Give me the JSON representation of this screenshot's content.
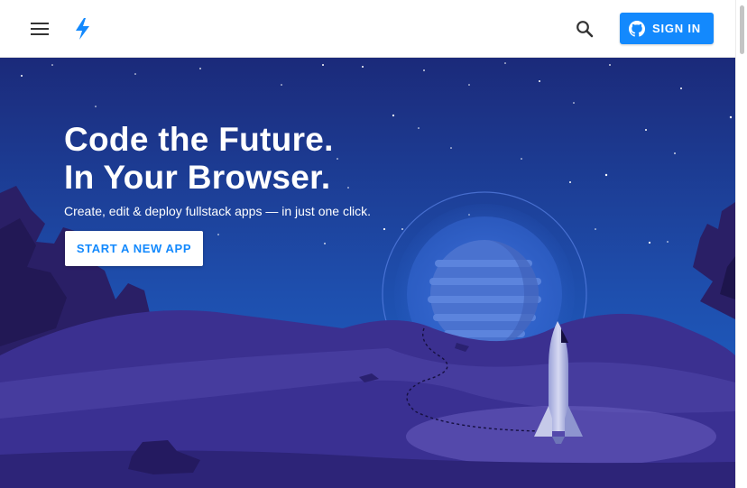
{
  "header": {
    "menu_icon": "hamburger-menu-icon",
    "logo_icon": "lightning-bolt-icon",
    "search_icon": "search-icon",
    "signin_icon": "github-icon",
    "signin_label": "SIGN IN"
  },
  "hero": {
    "headline_line1": "Code the Future.",
    "headline_line2": "In Your Browser.",
    "tagline": "Create, edit & deploy fullstack apps — in just one click.",
    "cta_label": "START A NEW APP"
  },
  "colors": {
    "accent": "#1389fd",
    "sky_top": "#1b2a7a",
    "sky_bottom": "#1e63c8",
    "ground": "#3d3593"
  }
}
